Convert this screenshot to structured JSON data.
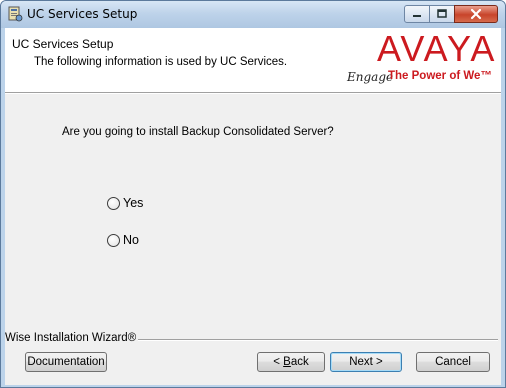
{
  "window": {
    "title": "UC Services Setup"
  },
  "header": {
    "title": "UC Services Setup",
    "description": "The following information is used by UC Services.",
    "logo": {
      "brand": "AVAYA",
      "engage": "Engage",
      "tagline": "The Power of We™",
      "color": "#cc1a1f"
    }
  },
  "main": {
    "question": "Are you going to install Backup Consolidated Server?",
    "options": [
      {
        "label": "Yes",
        "selected": false
      },
      {
        "label": "No",
        "selected": false
      }
    ]
  },
  "footer": {
    "wise_label": "Wise Installation Wizard®",
    "buttons": {
      "documentation": "Documentation",
      "back_mnemonic": "B",
      "back_rest": "ack",
      "back_prefix": "< ",
      "next": "Next >",
      "cancel": "Cancel"
    }
  },
  "icons": {
    "app": "installer-icon",
    "minimize": "minimize-icon",
    "maximize": "maximize-icon",
    "close": "close-icon"
  }
}
